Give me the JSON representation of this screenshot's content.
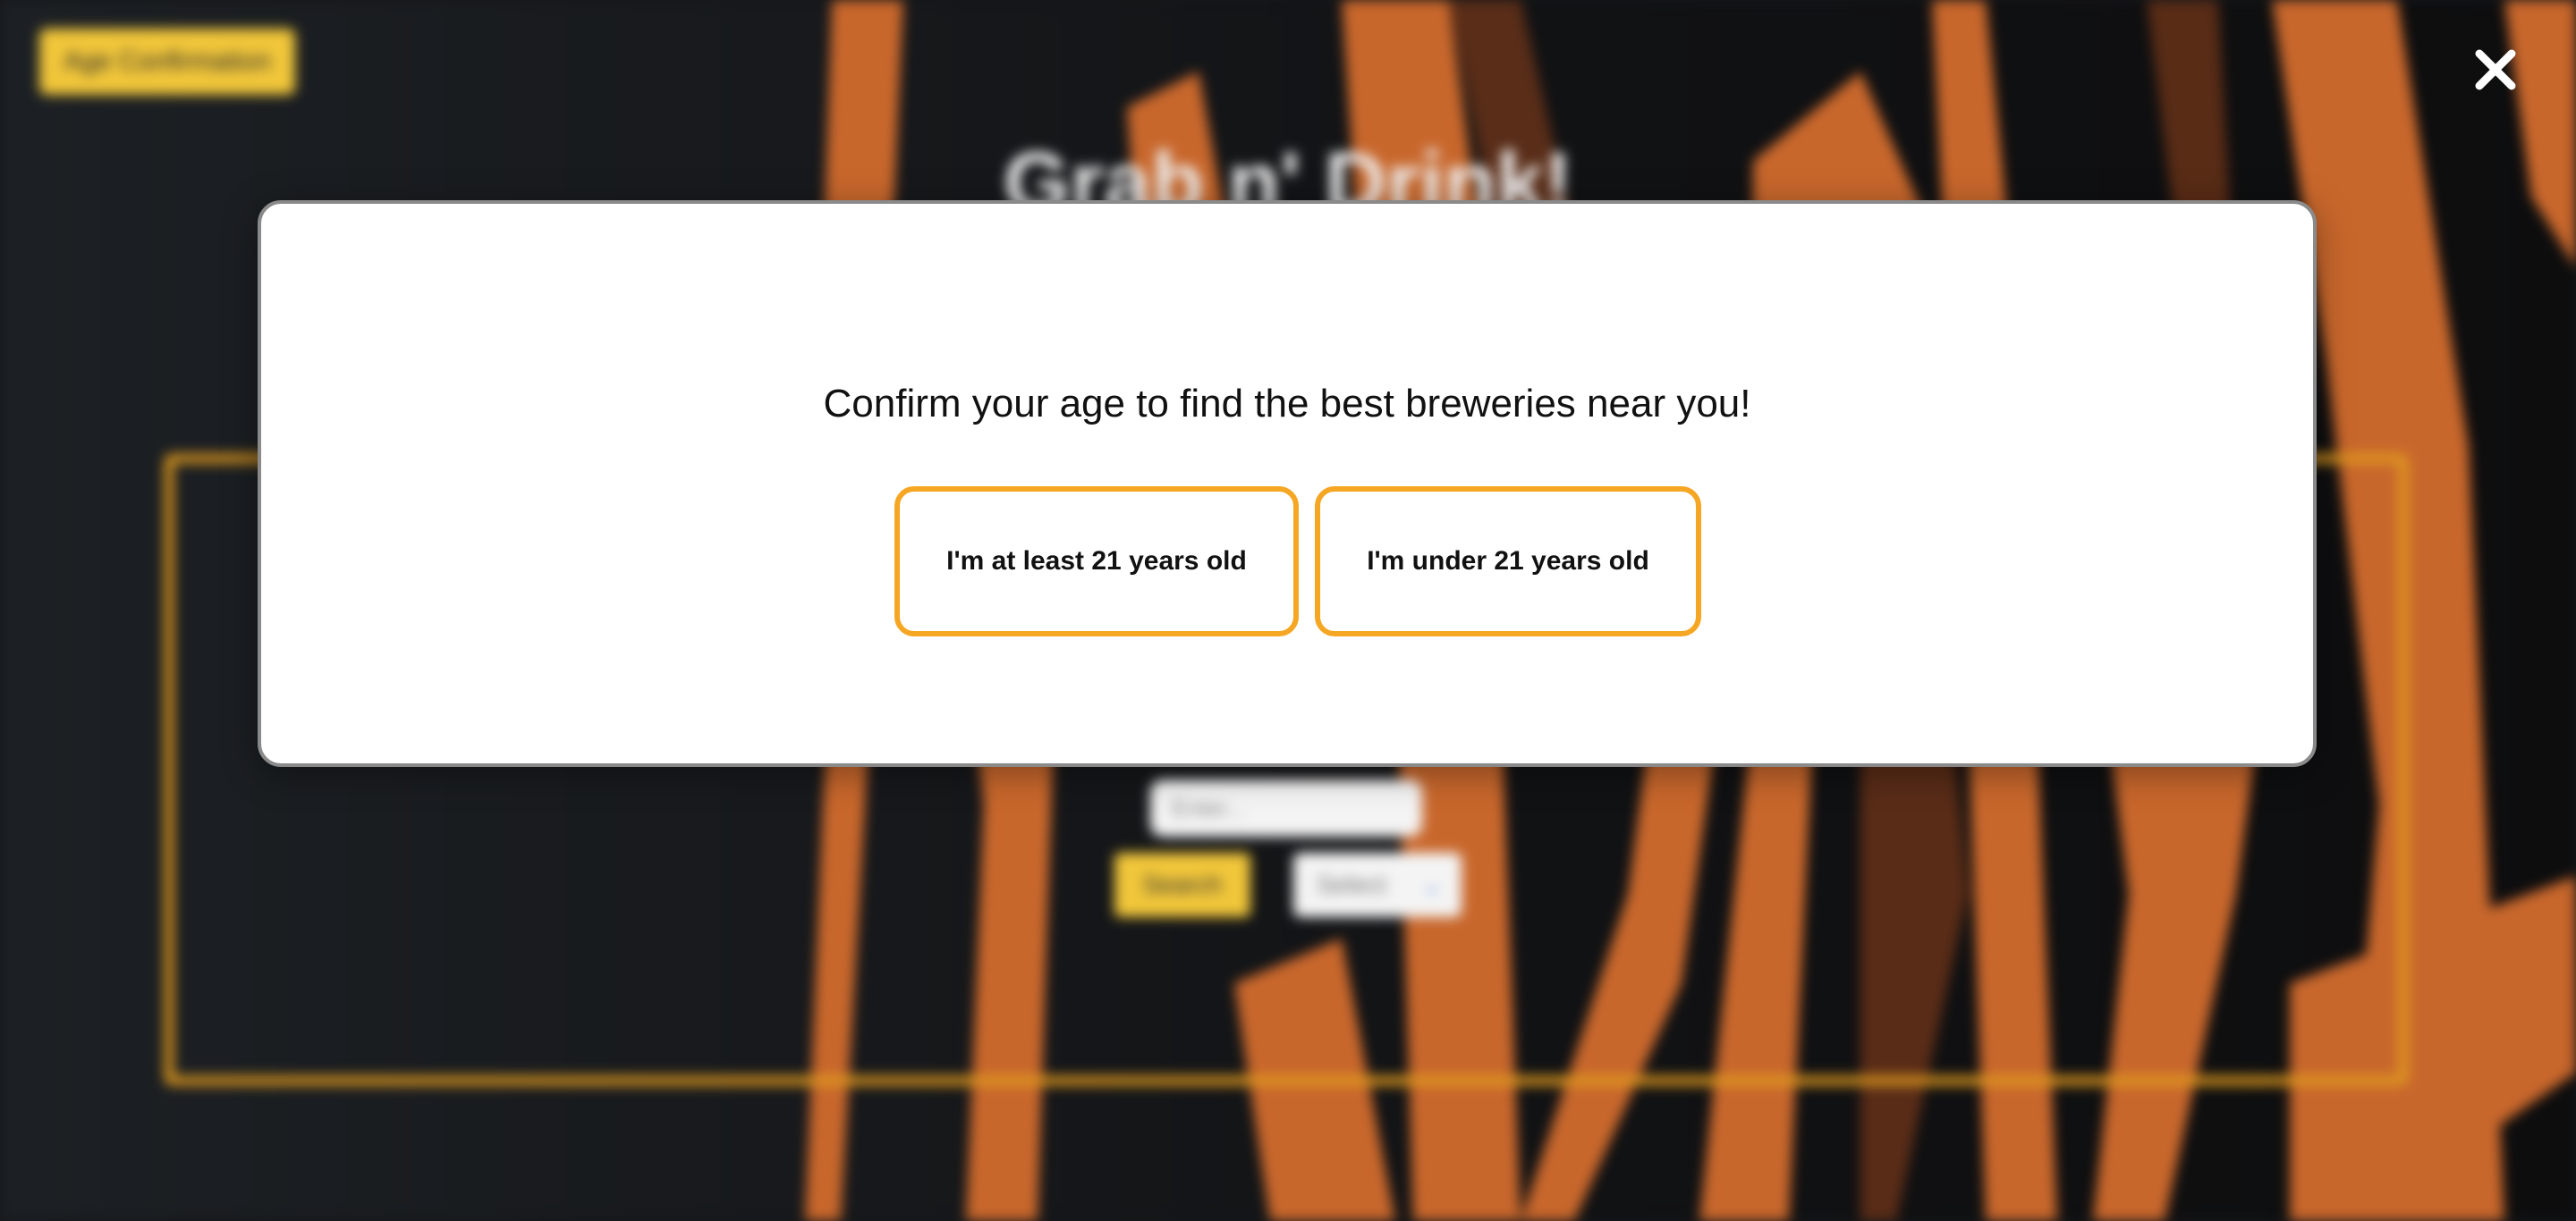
{
  "background": {
    "badge_label": "Age Confirmation",
    "site_title": "Grab n' Drink!",
    "search_placeholder": "Enter...",
    "search_button_label": "Search",
    "select_value": "Select",
    "select_arrow": "⌄"
  },
  "modal": {
    "heading": "Confirm your age to find the best breweries near you!",
    "buttons": {
      "over_21": "I'm at least 21 years old",
      "under_21": "I'm under 21 years old"
    }
  },
  "close_icon": "x-close",
  "colors": {
    "accent_orange": "#f5a623",
    "accent_yellow": "#f1c63a",
    "modal_bg": "#ffffff",
    "overlay_dark": "#15171a"
  }
}
